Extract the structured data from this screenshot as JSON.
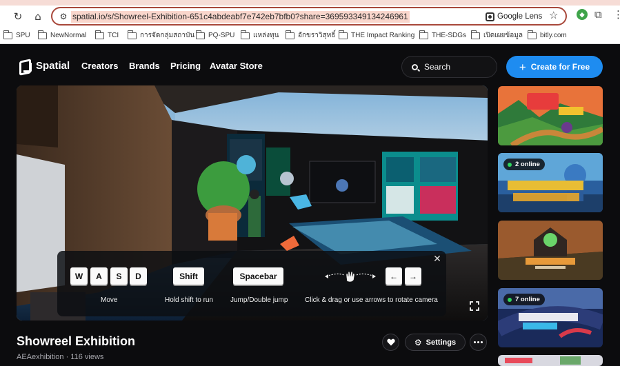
{
  "browser": {
    "url": "spatial.io/s/Showreel-Exhibition-651c4abdeabf7e742eb7bfb0?share=3695933491342469​61",
    "lens_label": "Google Lens",
    "bookmarks": [
      "SPU",
      "NewNormal",
      "TCI",
      "การจัดกลุ่มสถาบัน",
      "PQ-SPU",
      "แหล่งทุน",
      "อักขราวิสุทธิ์",
      "THE Impact Ranking",
      "THE-SDGs",
      "เปิดเผยข้อมูล",
      "bitly.com"
    ]
  },
  "header": {
    "brand": "Spatial",
    "nav": [
      "Creators",
      "Brands",
      "Pricing",
      "Avatar Store"
    ],
    "search_label": "Search",
    "cta_label": "Create for Free"
  },
  "controls": {
    "keys_move": [
      "W",
      "A",
      "S",
      "D"
    ],
    "key_shift": "Shift",
    "key_space": "Spacebar",
    "arrow_left": "←",
    "arrow_right": "→",
    "hint_move": "Move",
    "hint_run": "Hold shift to run",
    "hint_jump": "Jump/Double jump",
    "hint_camera": "Click & drag or use arrows to rotate camera"
  },
  "sidebar": {
    "cards": [
      {
        "name": "card-rfm",
        "badge": ""
      },
      {
        "name": "card-jailbreak",
        "badge": "2 online"
      },
      {
        "name": "card-woodland",
        "badge": ""
      },
      {
        "name": "card-superbike",
        "badge": "7 online"
      }
    ]
  },
  "space": {
    "title": "Showreel Exhibition",
    "creator": "AEAexhibition",
    "views": "116 views",
    "settings_label": "Settings"
  },
  "colors": {
    "accent": "#1e8cf0",
    "online_dot": "#2fd65e",
    "url_highlight": "#f9d6cc",
    "omnibox_border": "#a8473a"
  }
}
